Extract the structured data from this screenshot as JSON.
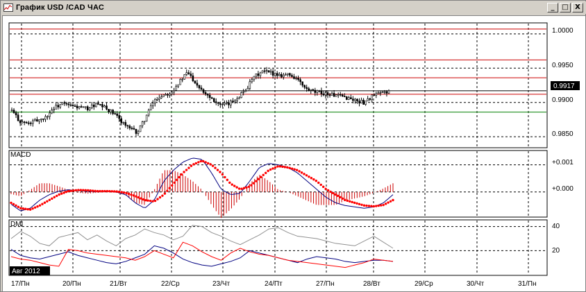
{
  "window": {
    "title": "График USD /CAD  ЧАС",
    "minimize_label": "_",
    "maximize_label": "□",
    "close_label": "X"
  },
  "price_panel": {
    "current_price_label": "0.9917",
    "y_ticks": [
      "1.0000",
      "0.9950",
      "0.9900",
      "0.9850"
    ]
  },
  "macd_panel": {
    "label": "MACD",
    "y_ticks": [
      "+0.001",
      "+0.000"
    ]
  },
  "dmi_panel": {
    "label": "DMI",
    "y_ticks": [
      "40",
      "20"
    ]
  },
  "x_axis": {
    "period_badge": "Авг 2012",
    "ticks": [
      "17/Пн",
      "20/Пн",
      "21/Вт",
      "22/Ср",
      "23/Чт",
      "24/Пт",
      "27/Пн",
      "28/Вт",
      "29/Ср",
      "30/Чт",
      "31/Пн"
    ]
  },
  "colors": {
    "background": "#ffffff",
    "grid": "#000000",
    "resistance_lines": "#cc0000",
    "support_line": "#008000",
    "candles": "#000000",
    "macd_line": "#000080",
    "macd_signal": "#ff0000",
    "macd_histogram": "#cc0000",
    "dmi_plus": "#000080",
    "dmi_minus": "#ff0000",
    "adx": "#909090"
  },
  "chart_data": [
    {
      "type": "candlestick",
      "title": "График USD /CAD  ЧАС",
      "x_ticks": [
        "17/Пн",
        "20/Пн",
        "21/Вт",
        "22/Ср",
        "23/Чт",
        "24/Пт",
        "27/Пн",
        "28/Вт",
        "29/Ср",
        "30/Чт",
        "31/Пн"
      ],
      "y_ticks": [
        1.0,
        0.995,
        0.99,
        0.985
      ],
      "ylim": [
        0.9835,
        1.0015
      ],
      "last_price": 0.9917,
      "horizontal_levels": {
        "resistance": [
          1.0007,
          0.9962,
          0.9936,
          0.9912
        ],
        "support": [
          0.9886
        ],
        "current": 0.9917
      },
      "close_path": [
        0.9888,
        0.9872,
        0.9869,
        0.9874,
        0.9878,
        0.9892,
        0.9898,
        0.9895,
        0.9893,
        0.9891,
        0.9897,
        0.9893,
        0.9885,
        0.9874,
        0.9862,
        0.9856,
        0.9879,
        0.9903,
        0.9911,
        0.9915,
        0.993,
        0.9944,
        0.9928,
        0.9915,
        0.9905,
        0.9895,
        0.9898,
        0.9908,
        0.992,
        0.9938,
        0.9945,
        0.9943,
        0.994,
        0.9941,
        0.9935,
        0.992,
        0.9915,
        0.9914,
        0.9912,
        0.9909,
        0.9907,
        0.9903,
        0.99,
        0.9909,
        0.9913,
        0.9917
      ]
    },
    {
      "type": "line",
      "name": "MACD",
      "y_ticks": [
        0.001,
        0.0
      ],
      "ylim": [
        -0.0009,
        0.0015
      ],
      "series": [
        {
          "values": [
            -0.00045,
            -0.0007,
            -0.0006,
            -0.0003,
            -0.0001,
            3e-05,
            8e-05,
            5e-05,
            2e-05,
            1e-05,
            3e-05,
            0.0,
            -0.0001,
            -0.0004,
            -0.0006,
            -0.0003,
            0.0004,
            0.0008,
            0.0011,
            0.00125,
            0.0012,
            0.0007,
            0.0001,
            -0.0001,
            -5e-05,
            0.0004,
            0.0009,
            0.00105,
            0.001,
            0.0009,
            0.0007,
            0.0004,
            0.0001,
            -0.0002,
            -0.0004,
            -0.0005,
            -0.00055,
            -0.0006,
            -0.00055,
            -0.0004,
            -0.0001
          ]
        },
        {
          "values": [
            -0.0004,
            -0.0006,
            -0.00065,
            -0.0005,
            -0.0003,
            -0.0001,
            3e-05,
            7e-05,
            6e-05,
            3e-05,
            3e-05,
            2e-05,
            -3e-05,
            -0.00015,
            -0.0003,
            -0.00035,
            -0.0001,
            0.0003,
            0.0007,
            0.001,
            0.00115,
            0.001,
            0.0007,
            0.0003,
            0.0001,
            0.0002,
            0.0005,
            0.0008,
            0.00095,
            0.0009,
            0.0008,
            0.0006,
            0.0004,
            0.0001,
            -0.0001,
            -0.0003,
            -0.0004,
            -0.0005,
            -0.00053,
            -0.00048,
            -0.0003
          ]
        }
      ]
    },
    {
      "type": "line",
      "name": "DMI",
      "y_ticks": [
        40,
        20
      ],
      "ylim": [
        0,
        45
      ],
      "series": [
        {
          "values": [
            21,
            16,
            14,
            13,
            15,
            17,
            19,
            16,
            14,
            12,
            10,
            9,
            11,
            14,
            17,
            24,
            22,
            18,
            13,
            10,
            8,
            7,
            9,
            11,
            14,
            20,
            18,
            16,
            14,
            12,
            10,
            13,
            15,
            14,
            13,
            11,
            10,
            11,
            12,
            12,
            11
          ]
        },
        {
          "values": [
            15,
            13,
            12,
            10,
            8,
            7,
            21,
            20,
            18,
            17,
            16,
            15,
            14,
            12,
            15,
            20,
            17,
            14,
            27,
            24,
            19,
            15,
            12,
            18,
            22,
            19,
            17,
            16,
            14,
            12,
            11,
            10,
            9,
            8,
            7,
            6,
            8,
            10,
            13,
            12,
            11
          ]
        },
        {
          "values": [
            30,
            36,
            32,
            26,
            24,
            31,
            33,
            35,
            29,
            33,
            28,
            24,
            30,
            33,
            38,
            35,
            33,
            29,
            32,
            41,
            40,
            35,
            32,
            28,
            25,
            29,
            33,
            38,
            39,
            35,
            32,
            31,
            30,
            28,
            26,
            25,
            24,
            28,
            32,
            27,
            22
          ]
        }
      ]
    }
  ]
}
